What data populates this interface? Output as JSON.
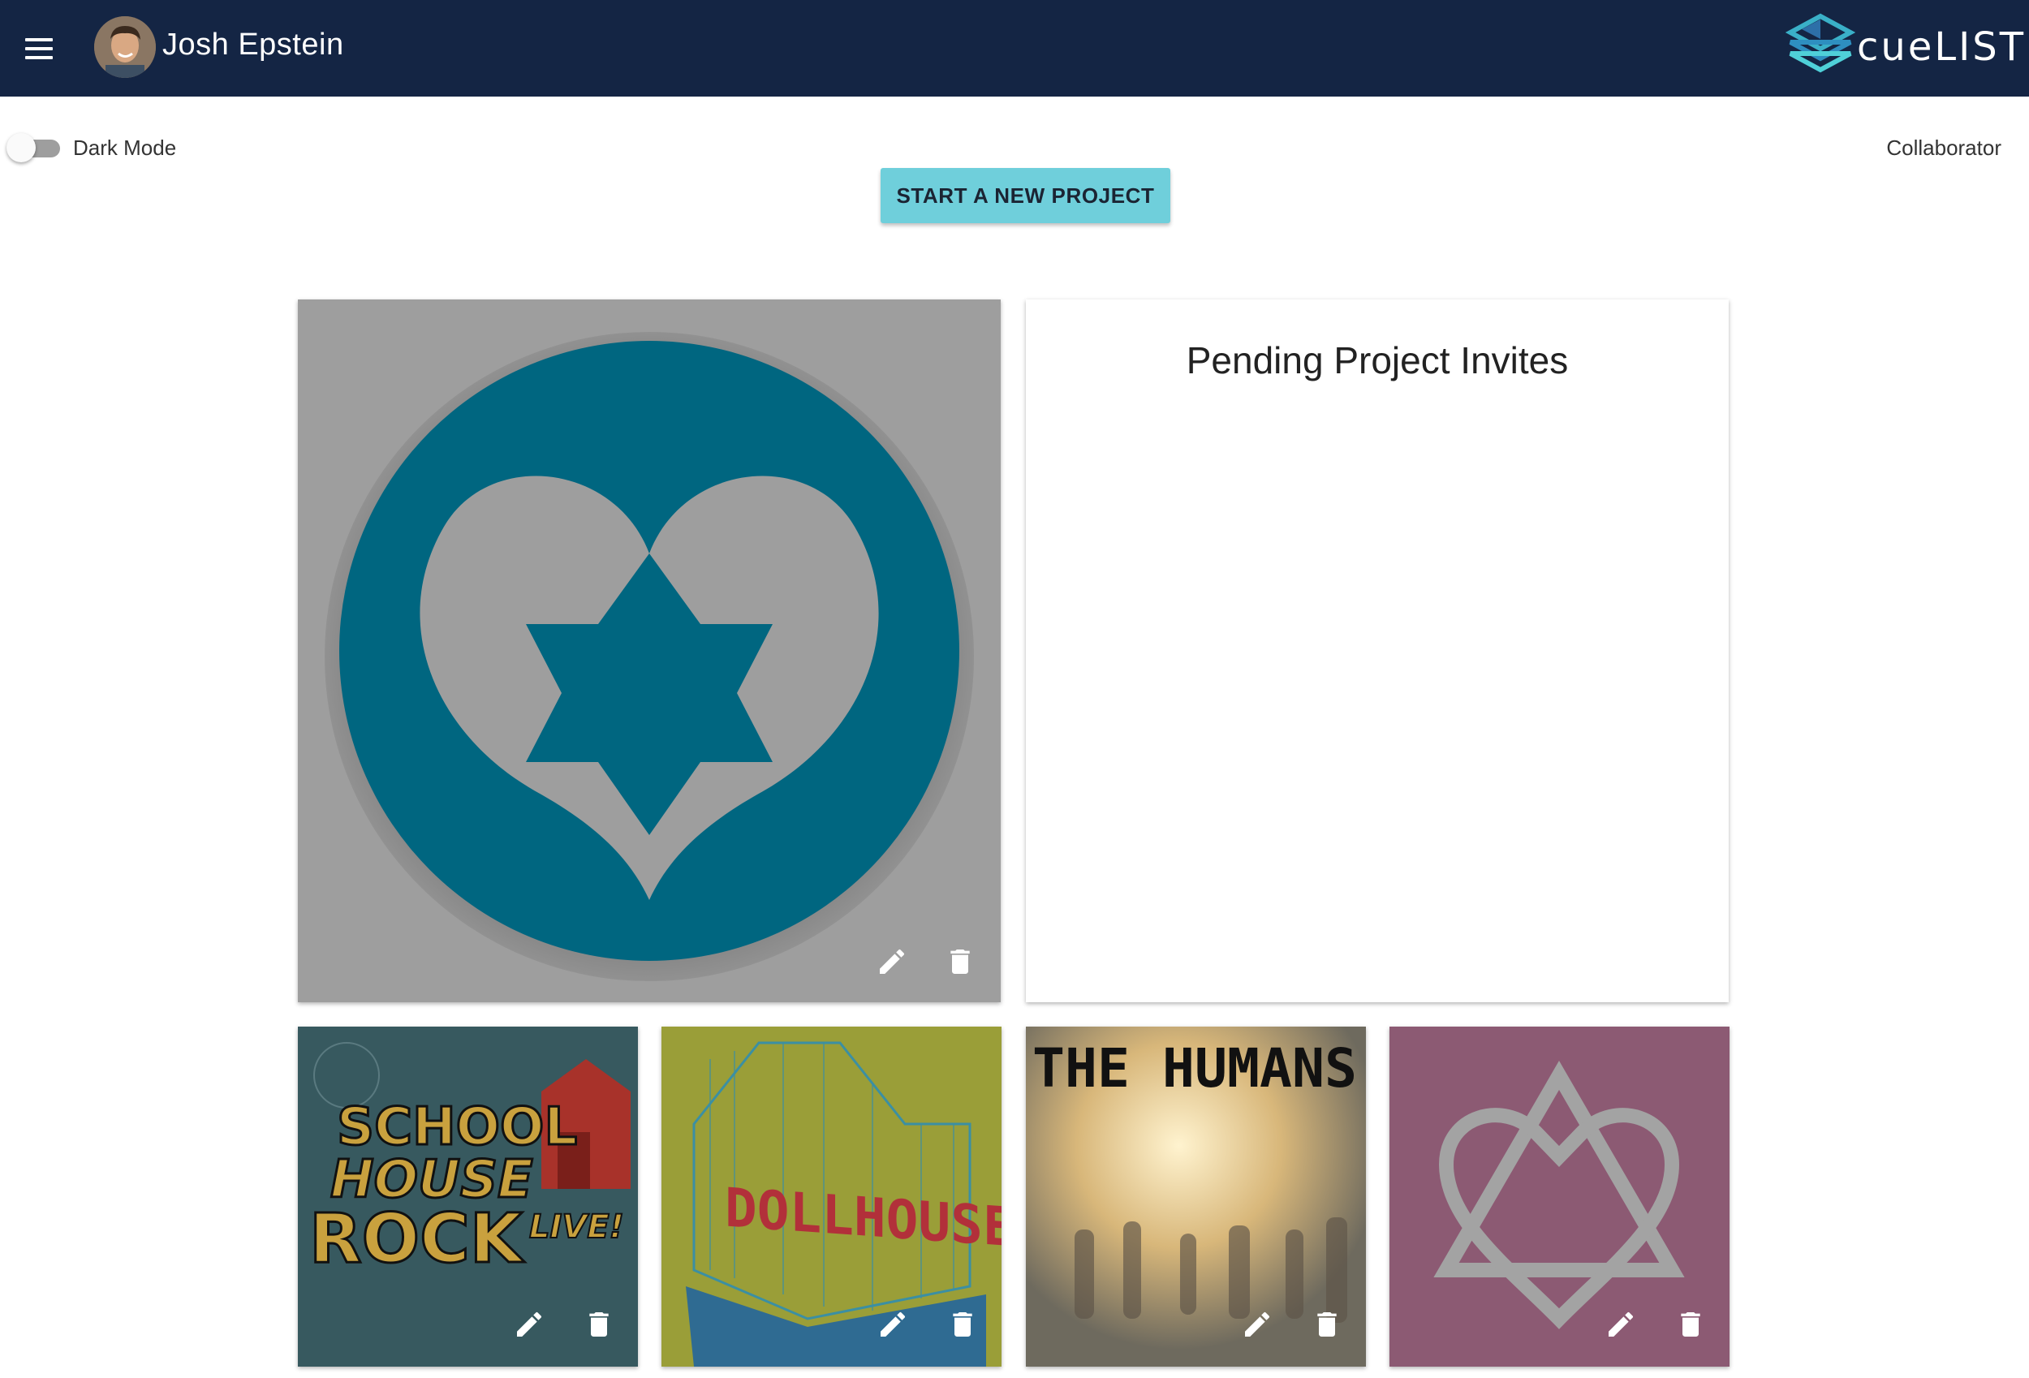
{
  "header": {
    "user_name": "Josh Epstein",
    "menu_icon": "hamburger-menu-icon",
    "logo_text": "cueLIST"
  },
  "toolbar": {
    "dark_mode_label": "Dark Mode",
    "dark_mode_on": false,
    "role_label": "Collaborator",
    "start_project_label": "START A NEW PROJECT"
  },
  "invites": {
    "title": "Pending Project Invites"
  },
  "projects": [
    {
      "art": "heart-star-of-david-logo",
      "actions": [
        "edit-icon",
        "delete-icon"
      ]
    },
    {
      "art_text": [
        "SCHOOL",
        "HOUSE",
        "ROCK",
        "LIVE!"
      ],
      "actions": [
        "edit-icon",
        "delete-icon"
      ]
    },
    {
      "art_text": [
        "DOLLHOUSE"
      ],
      "actions": [
        "edit-icon",
        "delete-icon"
      ]
    },
    {
      "art_text": [
        "THE HUMANS"
      ],
      "actions": [
        "edit-icon",
        "delete-icon"
      ]
    },
    {
      "art": "heart-triangle-logo",
      "actions": [
        "edit-icon",
        "delete-icon"
      ]
    }
  ],
  "colors": {
    "appbar": "#142544",
    "accent_button": "#6fcfdb",
    "big_card_bg": "#9e9e9e",
    "logo_teal": "#006680"
  }
}
